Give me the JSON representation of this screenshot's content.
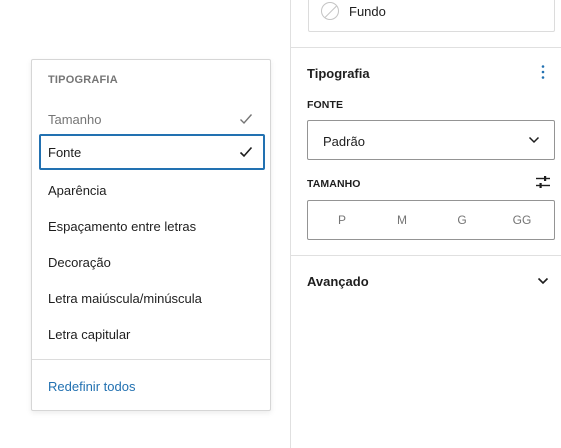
{
  "menu": {
    "heading": "TIPOGRAFIA",
    "items": [
      {
        "label": "Tamanho",
        "checked": true
      },
      {
        "label": "Fonte",
        "checked": true,
        "focused": true
      },
      {
        "label": "Aparência"
      },
      {
        "label": "Espaçamento entre letras"
      },
      {
        "label": "Decoração"
      },
      {
        "label": "Letra maiúscula/minúscula"
      },
      {
        "label": "Letra capitular"
      }
    ],
    "reset_label": "Redefinir todos"
  },
  "sidebar": {
    "background_item": {
      "label": "Fundo"
    },
    "typography": {
      "title": "Tipografia",
      "font_label": "FONTE",
      "font_value": "Padrão",
      "size_label": "TAMANHO",
      "size_options": [
        "P",
        "M",
        "G",
        "GG"
      ]
    },
    "advanced": {
      "title": "Avançado"
    }
  },
  "colors": {
    "accent": "#2271b1",
    "border": "#949494",
    "muted_text": "#757575",
    "text": "#1e1e1e"
  },
  "icons": {
    "check": "check-icon",
    "kebab": "more-vertical-icon",
    "select_chevron": "chevron-down-icon",
    "sliders": "sliders-icon",
    "swatch": "no-color-swatch-icon"
  }
}
